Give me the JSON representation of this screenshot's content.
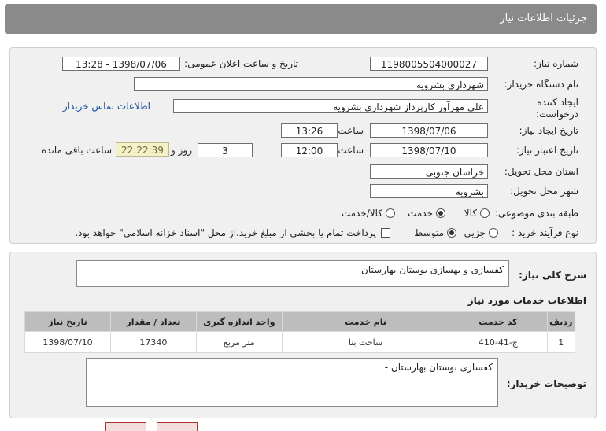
{
  "header": {
    "title": "جزئیات اطلاعات نیاز"
  },
  "form": {
    "need_number_label": "شماره نیاز:",
    "need_number": "1198005504000027",
    "announce_label": "تاریخ و ساعت اعلان عمومی:",
    "announce_value": "1398/07/06 - 13:28",
    "buyer_org_label": "نام دستگاه خریدار:",
    "buyer_org": "شهرداری بشرویه",
    "creator_label": "ایجاد کننده درخواست:",
    "creator": "علی مهرآور کارپرداز شهرداری بشرویه",
    "contact_link": "اطلاعات تماس خریدار",
    "create_date_label": "تاریخ ایجاد نیاز:",
    "create_date": "1398/07/06",
    "time_label": "ساعت",
    "create_time": "13:26",
    "validity_label": "تاریخ اعتبار نیاز:",
    "validity_date": "1398/07/10",
    "validity_time": "12:00",
    "days_value": "3",
    "days_label": "روز و",
    "remaining_time": "22:22:39",
    "remaining_label": "ساعت باقی مانده",
    "province_label": "استان محل تحویل:",
    "province": "خراسان جنوبی",
    "city_label": "شهر محل تحویل:",
    "city": "بشرویه",
    "category_label": "طبقه بندی موضوعی:",
    "category_options": [
      "کالا",
      "خدمت",
      "کالا/خدمت"
    ],
    "category_selected": "خدمت",
    "process_label": "نوع فرآیند خرید :",
    "process_options": [
      "جزیی",
      "متوسط"
    ],
    "process_selected": "متوسط",
    "payment_note": "پرداخت تمام یا بخشی از مبلغ خرید،از محل \"اسناد خزانه اسلامی\" خواهد بود."
  },
  "summary": {
    "label": "شرح کلی نیاز:",
    "value": "کفسازی و بهسازی بوستان بهارستان"
  },
  "services": {
    "title": "اطلاعات خدمات مورد نیاز",
    "columns": [
      "ردیف",
      "کد خدمت",
      "نام خدمت",
      "واحد اندازه گیری",
      "تعداد / مقدار",
      "تاریخ نیاز"
    ],
    "rows": [
      [
        "1",
        "ج-41-410",
        "ساخت بنا",
        "متر مربع",
        "17340",
        "1398/07/10"
      ]
    ]
  },
  "buyer_notes": {
    "label": "توضیحات خریدار:",
    "value": "کفسازی بوستان بهارستان -"
  }
}
